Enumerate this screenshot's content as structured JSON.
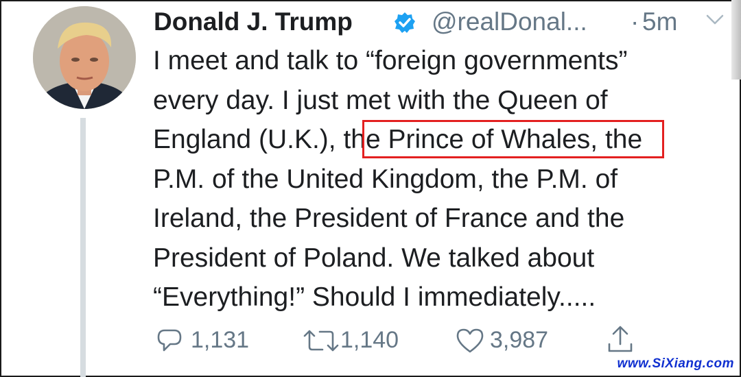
{
  "tweet": {
    "author_name": "Donald J. Trump",
    "handle": "@realDonal...",
    "separator": "·",
    "timestamp": "5m",
    "text_lines": [
      "I meet and talk to “foreign governments”",
      "every day. I just met with the Queen of",
      "England (U.K.), the Prince of Whales, the",
      "P.M. of the United Kingdom, the P.M. of",
      "Ireland, the President of France and the",
      "President of Poland. We talked about",
      "“Everything!” Should I immediately....."
    ],
    "highlighted_phrase": "the Prince of Whales"
  },
  "actions": {
    "replies": "1,131",
    "retweets": "1,140",
    "likes": "3,987"
  },
  "icons": {
    "reply": "speech-bubble-icon",
    "retweet": "retweet-arrows-icon",
    "like": "heart-icon",
    "share": "share-upload-icon",
    "verified": "verified-badge-icon",
    "menu": "chevron-down-icon"
  },
  "colors": {
    "verified_blue": "#1da1f2",
    "muted_text": "#657786",
    "highlight_border": "#e32020",
    "watermark": "#1030d0"
  },
  "watermark": "www.SiXiang.com"
}
